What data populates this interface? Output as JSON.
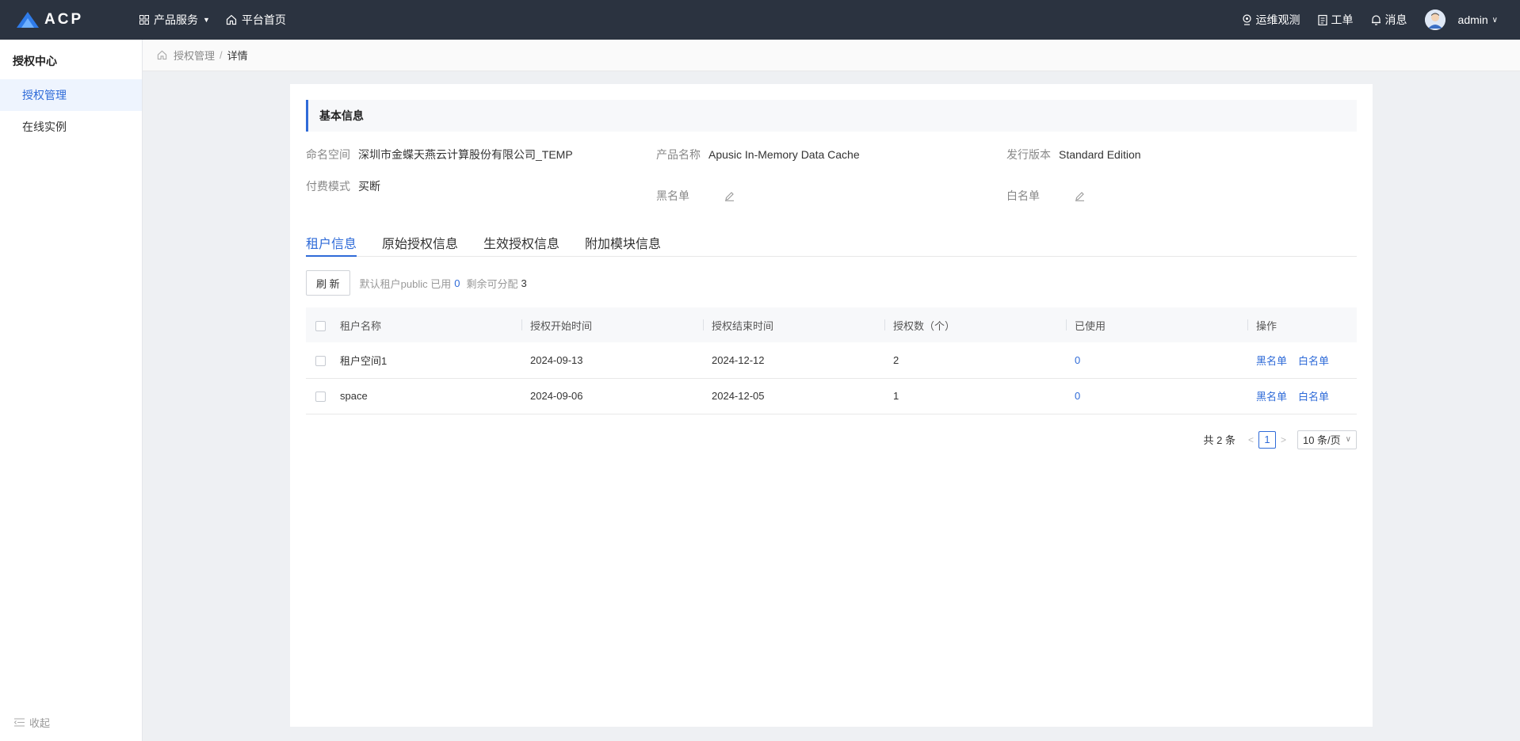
{
  "app": {
    "logo_text": "ACP",
    "nav": [
      {
        "label": "产品服务"
      },
      {
        "label": "平台首页"
      }
    ],
    "right": {
      "monitor": "运维观测",
      "ticket": "工单",
      "message": "消息",
      "user": "admin"
    }
  },
  "sidebar": {
    "title": "授权中心",
    "items": [
      {
        "label": "授权管理"
      },
      {
        "label": "在线实例"
      }
    ],
    "collapse": "收起"
  },
  "breadcrumb": {
    "parent": "授权管理",
    "separator": "/",
    "current": "详情"
  },
  "basic_info": {
    "title": "基本信息",
    "namespace_label": "命名空间",
    "namespace_value": "深圳市金蝶天燕云计算股份有限公司_TEMP",
    "product_label": "产品名称",
    "product_value": "Apusic In-Memory Data Cache",
    "edition_label": "发行版本",
    "edition_value": "Standard Edition",
    "billing_label": "付费模式",
    "billing_value": "买断",
    "blacklist_label": "黑名单",
    "whitelist_label": "白名单"
  },
  "tabs": [
    {
      "label": "租户信息"
    },
    {
      "label": "原始授权信息"
    },
    {
      "label": "生效授权信息"
    },
    {
      "label": "附加模块信息"
    }
  ],
  "toolbar": {
    "refresh": "刷 新",
    "default_text": "默认租户public 已用",
    "used_count": "0",
    "remaining_text": "剩余可分配",
    "remaining_count": "3"
  },
  "table": {
    "headers": [
      "租户名称",
      "授权开始时间",
      "授权结束时间",
      "授权数（个）",
      "已使用",
      "操作"
    ],
    "rows": [
      {
        "name": "租户空间1",
        "start": "2024-09-13",
        "end": "2024-12-12",
        "count": "2",
        "used": "0",
        "op1": "黑名单",
        "op2": "白名单"
      },
      {
        "name": "space",
        "start": "2024-09-06",
        "end": "2024-12-05",
        "count": "1",
        "used": "0",
        "op1": "黑名单",
        "op2": "白名单"
      }
    ]
  },
  "pagination": {
    "total": "共 2 条",
    "prev": "<",
    "page": "1",
    "next": ">",
    "page_size": "10 条/页"
  }
}
